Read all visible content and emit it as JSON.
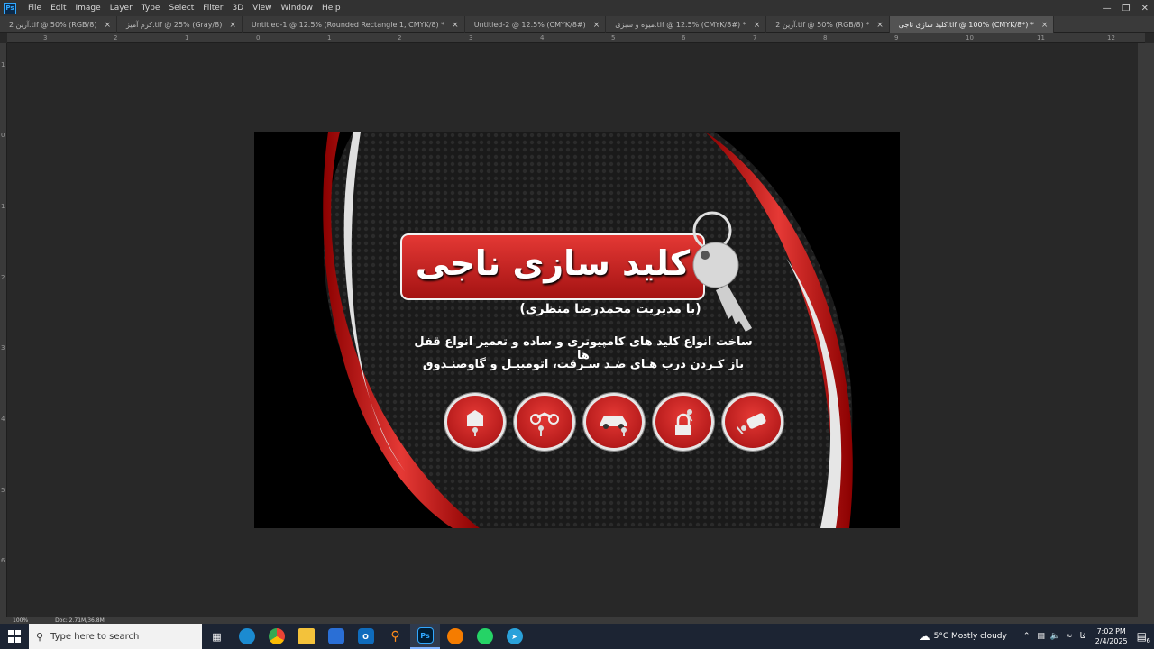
{
  "menu": [
    "File",
    "Edit",
    "Image",
    "Layer",
    "Type",
    "Select",
    "Filter",
    "3D",
    "View",
    "Window",
    "Help"
  ],
  "app_logo": "Ps",
  "tabs": [
    {
      "label": "آرین 2.tif @ 50% (RGB/8)",
      "active": false
    },
    {
      "label": "کرم آمیز.tif @ 25% (Gray/8)",
      "active": false
    },
    {
      "label": "Untitled-1 @ 12.5% (Rounded Rectangle 1, CMYK/8) *",
      "active": false
    },
    {
      "label": "Untitled-2 @ 12.5% (CMYK/8#)",
      "active": false
    },
    {
      "label": "میوه و سبزی.tif @ 12.5% (CMYK/8#) *",
      "active": false
    },
    {
      "label": "آرین 2.tif @ 50% (RGB/8) *",
      "active": false
    },
    {
      "label": "کلید سازی ناجی.tif @ 100% (CMYK/8*) *",
      "active": true
    }
  ],
  "ruler_h": [
    "3",
    "2",
    "1",
    "0",
    "1",
    "2",
    "3",
    "4",
    "5",
    "6",
    "7",
    "8",
    "9",
    "10",
    "11",
    "12"
  ],
  "ruler_v": [
    "1",
    "0",
    "1",
    "2",
    "3",
    "4",
    "5",
    "6"
  ],
  "artwork": {
    "title": "کلید سازی ناجی",
    "subtitle": "(با مدیریت محمدرضا منظری)",
    "line1": "ساخت انواع کلید های کامپیوتری و ساده و تعمیر انواع قفل ها",
    "line2": "باز کـردن درب هـای ضـد سـرقت، اتومبیـل و گاوصنـدوق",
    "icons": [
      "building-keys-icon",
      "motorcycle-key-icon",
      "car-key-icon",
      "padlock-keys-icon",
      "remote-key-icon"
    ],
    "accent": "#d32f2f"
  },
  "status": {
    "zoom": "100%",
    "doc": "Doc: 2.71M/36.8M"
  },
  "taskbar": {
    "search_placeholder": "Type here to search",
    "weather": "5°C  Mostly cloudy",
    "lang": "فا",
    "time": "7:02 PM",
    "date": "2/4/2025",
    "notif_count": "6"
  }
}
